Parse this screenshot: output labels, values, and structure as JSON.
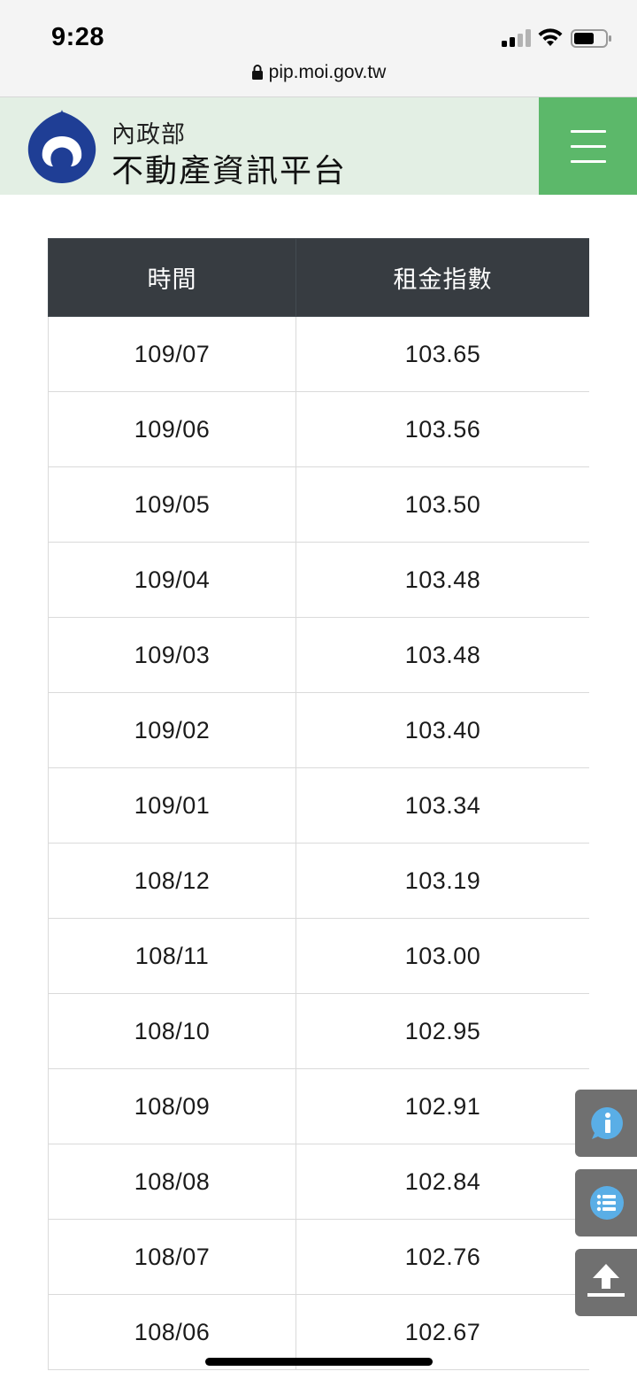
{
  "status": {
    "time": "9:28",
    "url": "pip.moi.gov.tw"
  },
  "header": {
    "ministry": "內政部",
    "platform": "不動產資訊平台"
  },
  "table": {
    "columns": [
      "時間",
      "租金指數"
    ],
    "rows": [
      [
        "109/07",
        "103.65"
      ],
      [
        "109/06",
        "103.56"
      ],
      [
        "109/05",
        "103.50"
      ],
      [
        "109/04",
        "103.48"
      ],
      [
        "109/03",
        "103.48"
      ],
      [
        "109/02",
        "103.40"
      ],
      [
        "109/01",
        "103.34"
      ],
      [
        "108/12",
        "103.19"
      ],
      [
        "108/11",
        "103.00"
      ],
      [
        "108/10",
        "102.95"
      ],
      [
        "108/09",
        "102.91"
      ],
      [
        "108/08",
        "102.84"
      ],
      [
        "108/07",
        "102.76"
      ],
      [
        "108/06",
        "102.67"
      ]
    ]
  },
  "floating": {
    "info_icon": "info-icon",
    "list_icon": "list-icon",
    "top_icon": "arrow-up-icon"
  },
  "colors": {
    "header_bg": "#e3efe4",
    "menu_green": "#5cb86a",
    "table_head": "#373c41",
    "fab_gray": "#707070",
    "icon_blue": "#5aaee6",
    "logo_blue": "#1f3e95"
  }
}
